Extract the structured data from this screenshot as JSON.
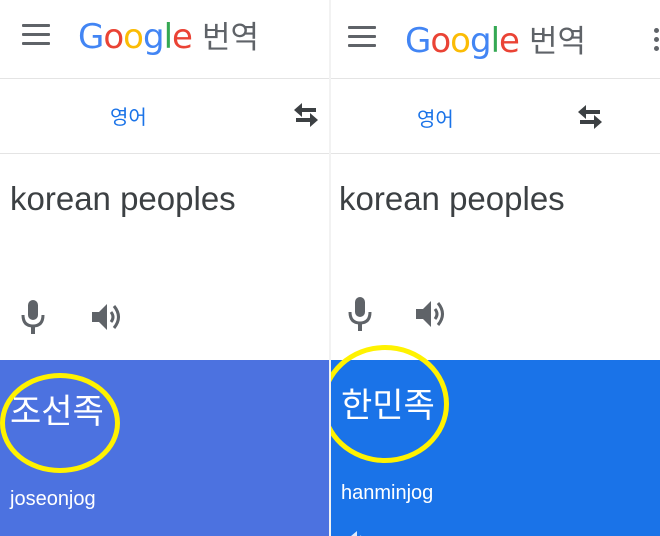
{
  "panels": [
    {
      "header": {
        "logo_text": "Google",
        "logo_suffix": "번역",
        "menu_icon": "hamburger-menu-icon"
      },
      "language": {
        "source_label": "영어",
        "swap_icon": "swap-arrows-icon"
      },
      "input": {
        "text": "korean peoples",
        "mic_icon": "microphone-icon",
        "speaker_icon": "speaker-icon"
      },
      "result": {
        "text": "조선족",
        "romanization": "joseonjog",
        "background": "#4c72e0"
      }
    },
    {
      "header": {
        "logo_text": "Google",
        "logo_suffix": "번역",
        "menu_icon": "hamburger-menu-icon",
        "more_icon": "more-vertical-icon"
      },
      "language": {
        "source_label": "영어",
        "swap_icon": "swap-arrows-icon"
      },
      "input": {
        "text": "korean peoples",
        "mic_icon": "microphone-icon",
        "speaker_icon": "speaker-icon"
      },
      "result": {
        "text": "한민족",
        "romanization": "hanminjog",
        "background": "#1a73e8"
      }
    }
  ],
  "colors": {
    "google_blue": "#4285f4",
    "google_red": "#ea4335",
    "google_yellow": "#fbbc05",
    "google_green": "#34a853",
    "highlight_circle": "#fff200",
    "accent": "#1a73e8"
  }
}
